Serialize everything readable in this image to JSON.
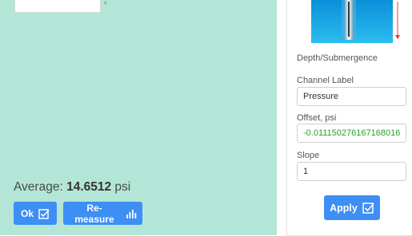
{
  "measurement": {
    "average_label": "Average:",
    "average_value": "14.6512",
    "average_unit": "psi",
    "ok_label": "Ok",
    "remeasure_label": "Re-measure"
  },
  "settings": {
    "mode_label": "Depth/Submergence",
    "channel_label": "Channel Label",
    "channel_value": "Pressure",
    "offset_label": "Offset, psi",
    "offset_value": "-0.011150276167168016",
    "slope_label": "Slope",
    "slope_value": "1",
    "apply_label": "Apply"
  },
  "colors": {
    "panel_background": "#b3e6d6",
    "button_blue": "#3d8ef5",
    "offset_text_green": "#2c9c2c"
  },
  "icons": {
    "ok": "checkbox-check-icon",
    "remeasure": "bar-chart-icon",
    "apply": "checkbox-check-icon",
    "sensor": "sensor-depth-illustration"
  }
}
